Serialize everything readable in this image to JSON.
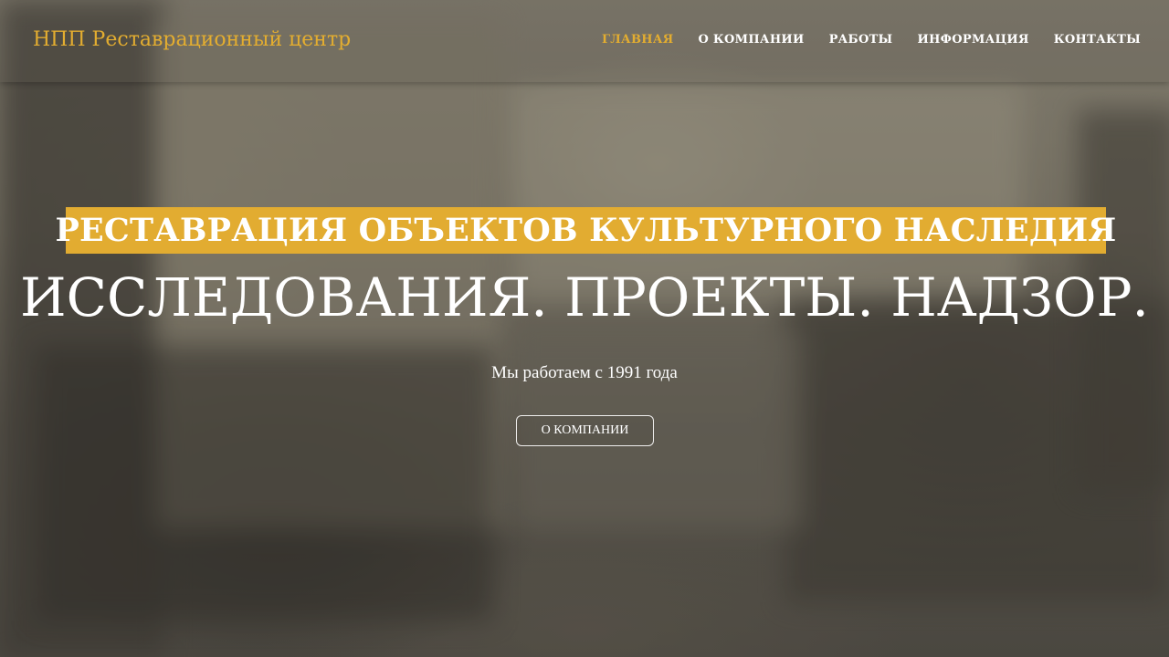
{
  "header": {
    "brand": "НПП Реставрационный центр",
    "nav": [
      {
        "label": "ГЛАВНАЯ",
        "active": true
      },
      {
        "label": "О КОМПАНИИ",
        "active": false
      },
      {
        "label": "РАБОТЫ",
        "active": false
      },
      {
        "label": "ИНФОРМАЦИЯ",
        "active": false
      },
      {
        "label": "КОНТАКТЫ",
        "active": false
      }
    ]
  },
  "hero": {
    "tagline": "РЕСТАВРАЦИЯ ОБЪЕКТОВ КУЛЬТУРНОГО НАСЛЕДИЯ",
    "headline": "ИССЛЕДОВАНИЯ. ПРОЕКТЫ. НАДЗОР.",
    "subtext": "Мы работаем с 1991 года",
    "button_label": "О КОМПАНИИ"
  },
  "colors": {
    "accent": "#e2ac31",
    "text": "#ffffff"
  }
}
